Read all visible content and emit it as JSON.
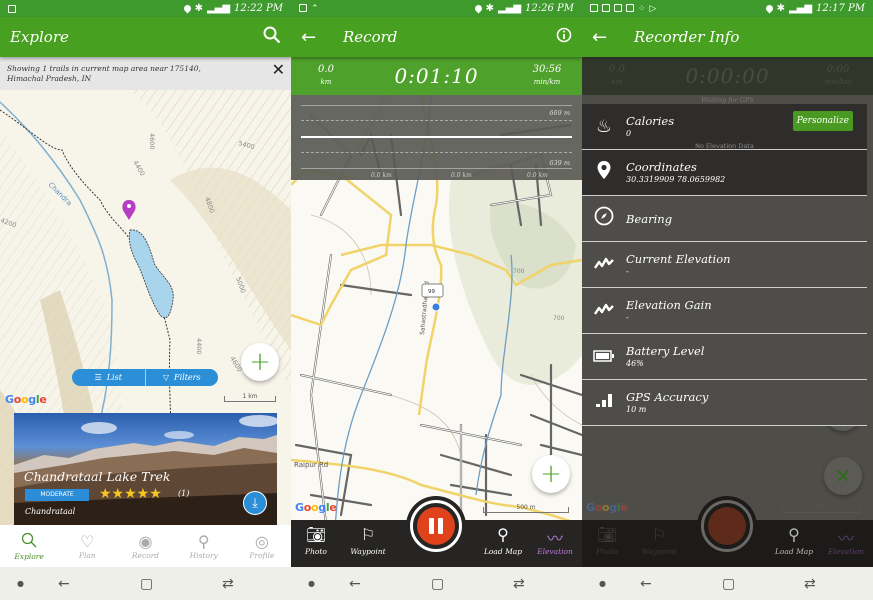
{
  "screens": [
    {
      "status": {
        "time": "12:22 PM"
      },
      "appbar": {
        "title": "Explore",
        "search_icon": "search-icon"
      },
      "infobar": {
        "text_line1": "Showing 1 trails in current map area  near 175140,",
        "text_line2": "Himachal Pradesh, IN",
        "close_icon": "close-icon"
      },
      "map": {
        "river_label": "Chandra",
        "contour_labels": [
          "4600",
          "5400",
          "4400",
          "4800",
          "5000",
          "4200",
          "4400",
          "4600"
        ],
        "scale_label": "1 km",
        "google_label": "Google"
      },
      "segmented": {
        "list_label": "List",
        "filters_label": "Filters"
      },
      "fab_label": "+",
      "trail_card": {
        "title": "Chandrataal Lake Trek",
        "difficulty": "MODERATE",
        "rating": 5,
        "rating_max": 5,
        "stars": "★★★★★",
        "review_count": "(1)",
        "location": "Chandrataal"
      },
      "bottom_nav": [
        {
          "label": "Explore",
          "icon": "search-icon",
          "active": true
        },
        {
          "label": "Plan",
          "icon": "heart-icon",
          "active": false
        },
        {
          "label": "Record",
          "icon": "record-icon",
          "active": false
        },
        {
          "label": "History",
          "icon": "history-pin-icon",
          "active": false
        },
        {
          "label": "Profile",
          "icon": "profile-icon",
          "active": false
        }
      ]
    },
    {
      "status": {
        "time": "12:26 PM"
      },
      "appbar": {
        "title": "Record",
        "back_icon": "back-arrow-icon",
        "info_icon": "info-icon"
      },
      "stats": {
        "distance": "0.0",
        "distance_unit": "km",
        "timer": "0:01:10",
        "pace": "30:56",
        "pace_unit": "min/km"
      },
      "elevation_chart": {
        "max_label": "669 m",
        "min_label": "639 m",
        "x_labels": [
          "0.0 km",
          "0.0 km",
          "0.0 km"
        ]
      },
      "map": {
        "road_labels": [
          "Raipur Rd",
          "Sahastradhara Rd",
          "Sahastradhara Rd",
          "Raipur Rd",
          "Sahastradhara Rd"
        ],
        "contour_labels": [
          "700",
          "700",
          "700"
        ],
        "marker_label": "99",
        "scale_label": "500 m",
        "google_label": "Google"
      },
      "fab_label": "+",
      "record_bar": [
        {
          "label": "Photo",
          "icon": "camera-icon"
        },
        {
          "label": "Waypoint",
          "icon": "flag-icon"
        },
        {
          "label": "Load Map",
          "icon": "map-pin-icon"
        },
        {
          "label": "Elevation",
          "icon": "elevation-icon"
        }
      ]
    },
    {
      "status": {
        "time": "12:17 PM"
      },
      "appbar": {
        "title": "Recorder Info",
        "back_icon": "back-arrow-icon"
      },
      "stats": {
        "distance": "0.0",
        "distance_unit": "km",
        "timer": "0:00:00",
        "pace": "0:00",
        "pace_unit": "min/km"
      },
      "waiting_text": "Waiting for GPS",
      "no_elevation_text": "No Elevation Data",
      "rows": [
        {
          "label": "Calories",
          "value": "0",
          "icon": "flame-icon",
          "button": "Personalize"
        },
        {
          "label": "Coordinates",
          "value": "30.3319909 78.0659982",
          "icon": "location-pin-icon"
        },
        {
          "label": "Bearing",
          "value": "",
          "icon": "compass-icon"
        },
        {
          "label": "Current Elevation",
          "value": "-",
          "icon": "elevation-icon"
        },
        {
          "label": "Elevation Gain",
          "value": "-",
          "icon": "elevation-icon"
        },
        {
          "label": "Battery Level",
          "value": "46%",
          "icon": "battery-icon"
        },
        {
          "label": "GPS Accuracy",
          "value": "10 m",
          "icon": "signal-bars-icon"
        }
      ],
      "map": {
        "scale_label": "500 m",
        "google_label": "Google"
      },
      "record_bar": [
        {
          "label": "Photo",
          "icon": "camera-icon"
        },
        {
          "label": "Waypoint",
          "icon": "flag-icon"
        },
        {
          "label": "Load Map",
          "icon": "map-pin-icon"
        },
        {
          "label": "Elevation",
          "icon": "elevation-icon"
        }
      ]
    }
  ],
  "colors": {
    "appbar_green": "#47a01f",
    "status_green": "#3e9a2c",
    "accent_blue": "#2a8fd6",
    "record_red": "#e0421c",
    "elevation_purple": "#b979d9",
    "star_yellow": "#f6c623"
  }
}
